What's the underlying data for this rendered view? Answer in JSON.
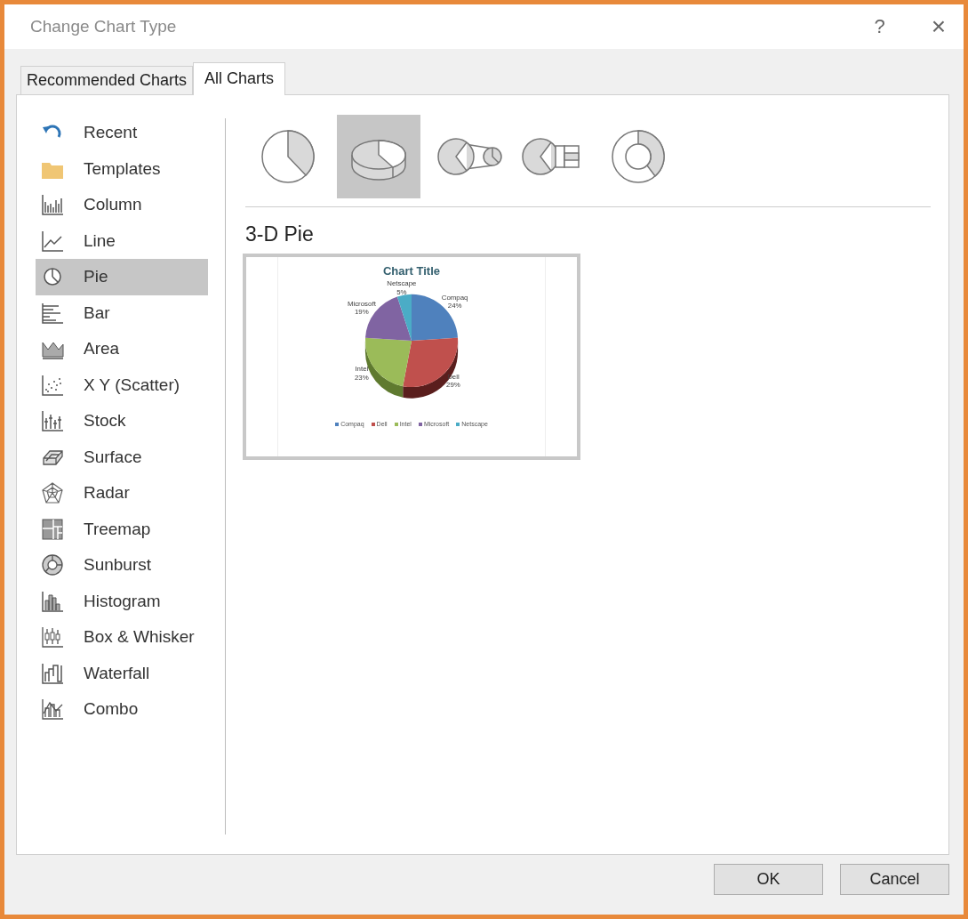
{
  "window": {
    "title": "Change Chart Type",
    "help": "?",
    "close": "×"
  },
  "tabs": [
    {
      "label": "Recommended Charts",
      "selected": false
    },
    {
      "label": "All Charts",
      "selected": true
    }
  ],
  "chart_types": [
    {
      "label": "Recent",
      "kind": "recent",
      "selected": false
    },
    {
      "label": "Templates",
      "kind": "templates",
      "selected": false
    },
    {
      "label": "Column",
      "kind": "column",
      "selected": false
    },
    {
      "label": "Line",
      "kind": "line",
      "selected": false
    },
    {
      "label": "Pie",
      "kind": "pie",
      "selected": true
    },
    {
      "label": "Bar",
      "kind": "bar",
      "selected": false
    },
    {
      "label": "Area",
      "kind": "area",
      "selected": false
    },
    {
      "label": "X Y (Scatter)",
      "kind": "scatter",
      "selected": false
    },
    {
      "label": "Stock",
      "kind": "stock",
      "selected": false
    },
    {
      "label": "Surface",
      "kind": "surface",
      "selected": false
    },
    {
      "label": "Radar",
      "kind": "radar",
      "selected": false
    },
    {
      "label": "Treemap",
      "kind": "treemap",
      "selected": false
    },
    {
      "label": "Sunburst",
      "kind": "sunburst",
      "selected": false
    },
    {
      "label": "Histogram",
      "kind": "histogram",
      "selected": false
    },
    {
      "label": "Box & Whisker",
      "kind": "boxwhisker",
      "selected": false
    },
    {
      "label": "Waterfall",
      "kind": "waterfall",
      "selected": false
    },
    {
      "label": "Combo",
      "kind": "combo",
      "selected": false
    }
  ],
  "subtypes": [
    {
      "kind": "pie",
      "selected": false
    },
    {
      "kind": "pie3d",
      "selected": true
    },
    {
      "kind": "pieofpie",
      "selected": false
    },
    {
      "kind": "barofpie",
      "selected": false
    },
    {
      "kind": "doughnut",
      "selected": false
    }
  ],
  "subtype_title": "3-D Pie",
  "preview": {
    "chart_data": {
      "type": "pie",
      "title": "Chart Title",
      "categories": [
        "Compaq",
        "Dell",
        "Intel",
        "Microsoft",
        "Netscape"
      ],
      "values": [
        24,
        29,
        23,
        19,
        5
      ],
      "legend": "bottom",
      "data_labels": true,
      "value_labels": [
        "24%",
        "29%",
        "23%",
        "19%",
        "5%"
      ]
    }
  },
  "buttons": [
    "OK",
    "Cancel"
  ]
}
